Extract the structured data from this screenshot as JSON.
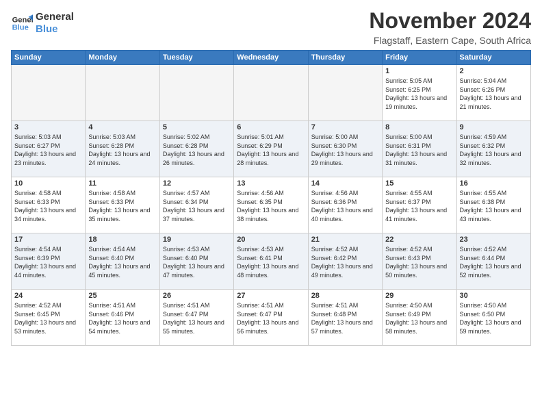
{
  "logo": {
    "line1": "General",
    "line2": "Blue"
  },
  "title": "November 2024",
  "location": "Flagstaff, Eastern Cape, South Africa",
  "days_of_week": [
    "Sunday",
    "Monday",
    "Tuesday",
    "Wednesday",
    "Thursday",
    "Friday",
    "Saturday"
  ],
  "weeks": [
    [
      {
        "day": "",
        "info": ""
      },
      {
        "day": "",
        "info": ""
      },
      {
        "day": "",
        "info": ""
      },
      {
        "day": "",
        "info": ""
      },
      {
        "day": "",
        "info": ""
      },
      {
        "day": "1",
        "info": "Sunrise: 5:05 AM\nSunset: 6:25 PM\nDaylight: 13 hours and 19 minutes."
      },
      {
        "day": "2",
        "info": "Sunrise: 5:04 AM\nSunset: 6:26 PM\nDaylight: 13 hours and 21 minutes."
      }
    ],
    [
      {
        "day": "3",
        "info": "Sunrise: 5:03 AM\nSunset: 6:27 PM\nDaylight: 13 hours and 23 minutes."
      },
      {
        "day": "4",
        "info": "Sunrise: 5:03 AM\nSunset: 6:28 PM\nDaylight: 13 hours and 24 minutes."
      },
      {
        "day": "5",
        "info": "Sunrise: 5:02 AM\nSunset: 6:28 PM\nDaylight: 13 hours and 26 minutes."
      },
      {
        "day": "6",
        "info": "Sunrise: 5:01 AM\nSunset: 6:29 PM\nDaylight: 13 hours and 28 minutes."
      },
      {
        "day": "7",
        "info": "Sunrise: 5:00 AM\nSunset: 6:30 PM\nDaylight: 13 hours and 29 minutes."
      },
      {
        "day": "8",
        "info": "Sunrise: 5:00 AM\nSunset: 6:31 PM\nDaylight: 13 hours and 31 minutes."
      },
      {
        "day": "9",
        "info": "Sunrise: 4:59 AM\nSunset: 6:32 PM\nDaylight: 13 hours and 32 minutes."
      }
    ],
    [
      {
        "day": "10",
        "info": "Sunrise: 4:58 AM\nSunset: 6:33 PM\nDaylight: 13 hours and 34 minutes."
      },
      {
        "day": "11",
        "info": "Sunrise: 4:58 AM\nSunset: 6:33 PM\nDaylight: 13 hours and 35 minutes."
      },
      {
        "day": "12",
        "info": "Sunrise: 4:57 AM\nSunset: 6:34 PM\nDaylight: 13 hours and 37 minutes."
      },
      {
        "day": "13",
        "info": "Sunrise: 4:56 AM\nSunset: 6:35 PM\nDaylight: 13 hours and 38 minutes."
      },
      {
        "day": "14",
        "info": "Sunrise: 4:56 AM\nSunset: 6:36 PM\nDaylight: 13 hours and 40 minutes."
      },
      {
        "day": "15",
        "info": "Sunrise: 4:55 AM\nSunset: 6:37 PM\nDaylight: 13 hours and 41 minutes."
      },
      {
        "day": "16",
        "info": "Sunrise: 4:55 AM\nSunset: 6:38 PM\nDaylight: 13 hours and 43 minutes."
      }
    ],
    [
      {
        "day": "17",
        "info": "Sunrise: 4:54 AM\nSunset: 6:39 PM\nDaylight: 13 hours and 44 minutes."
      },
      {
        "day": "18",
        "info": "Sunrise: 4:54 AM\nSunset: 6:40 PM\nDaylight: 13 hours and 45 minutes."
      },
      {
        "day": "19",
        "info": "Sunrise: 4:53 AM\nSunset: 6:40 PM\nDaylight: 13 hours and 47 minutes."
      },
      {
        "day": "20",
        "info": "Sunrise: 4:53 AM\nSunset: 6:41 PM\nDaylight: 13 hours and 48 minutes."
      },
      {
        "day": "21",
        "info": "Sunrise: 4:52 AM\nSunset: 6:42 PM\nDaylight: 13 hours and 49 minutes."
      },
      {
        "day": "22",
        "info": "Sunrise: 4:52 AM\nSunset: 6:43 PM\nDaylight: 13 hours and 50 minutes."
      },
      {
        "day": "23",
        "info": "Sunrise: 4:52 AM\nSunset: 6:44 PM\nDaylight: 13 hours and 52 minutes."
      }
    ],
    [
      {
        "day": "24",
        "info": "Sunrise: 4:52 AM\nSunset: 6:45 PM\nDaylight: 13 hours and 53 minutes."
      },
      {
        "day": "25",
        "info": "Sunrise: 4:51 AM\nSunset: 6:46 PM\nDaylight: 13 hours and 54 minutes."
      },
      {
        "day": "26",
        "info": "Sunrise: 4:51 AM\nSunset: 6:47 PM\nDaylight: 13 hours and 55 minutes."
      },
      {
        "day": "27",
        "info": "Sunrise: 4:51 AM\nSunset: 6:47 PM\nDaylight: 13 hours and 56 minutes."
      },
      {
        "day": "28",
        "info": "Sunrise: 4:51 AM\nSunset: 6:48 PM\nDaylight: 13 hours and 57 minutes."
      },
      {
        "day": "29",
        "info": "Sunrise: 4:50 AM\nSunset: 6:49 PM\nDaylight: 13 hours and 58 minutes."
      },
      {
        "day": "30",
        "info": "Sunrise: 4:50 AM\nSunset: 6:50 PM\nDaylight: 13 hours and 59 minutes."
      }
    ]
  ]
}
